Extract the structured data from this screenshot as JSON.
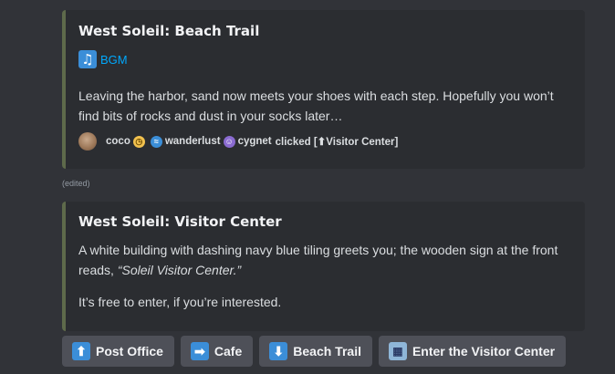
{
  "embed1": {
    "title": "West Soleil: Beach Trail",
    "bgm_label": "BGM",
    "description": "Leaving the harbor, sand now meets your shoes with each step. Hopefully you won’t find bits of rocks and dust in your socks later…",
    "clicked_users": [
      "coco",
      "wanderlust",
      "cygnet"
    ],
    "clicked_suffix": "clicked [⬆Visitor Center]"
  },
  "edited_label": "(edited)",
  "embed2": {
    "title": "West Soleil: Visitor Center",
    "description_part1": "A white building with dashing navy blue tiling greets you; the wooden sign at the front reads, ",
    "description_quote": "“Soleil Visitor Center.”",
    "description2": "It’s free to enter, if you’re interested."
  },
  "buttons": [
    {
      "icon": "arrow-up-icon",
      "label": "Post Office"
    },
    {
      "icon": "arrow-right-icon",
      "label": "Cafe"
    },
    {
      "icon": "arrow-down-icon",
      "label": "Beach Trail"
    },
    {
      "icon": "building-icon",
      "label": "Enter the Visitor Center"
    }
  ],
  "colors": {
    "background": "#313338",
    "embed_background": "#2b2d31",
    "embed_accent": "#5e6a4b",
    "button_background": "#4e5058",
    "link": "#00a8fc"
  }
}
